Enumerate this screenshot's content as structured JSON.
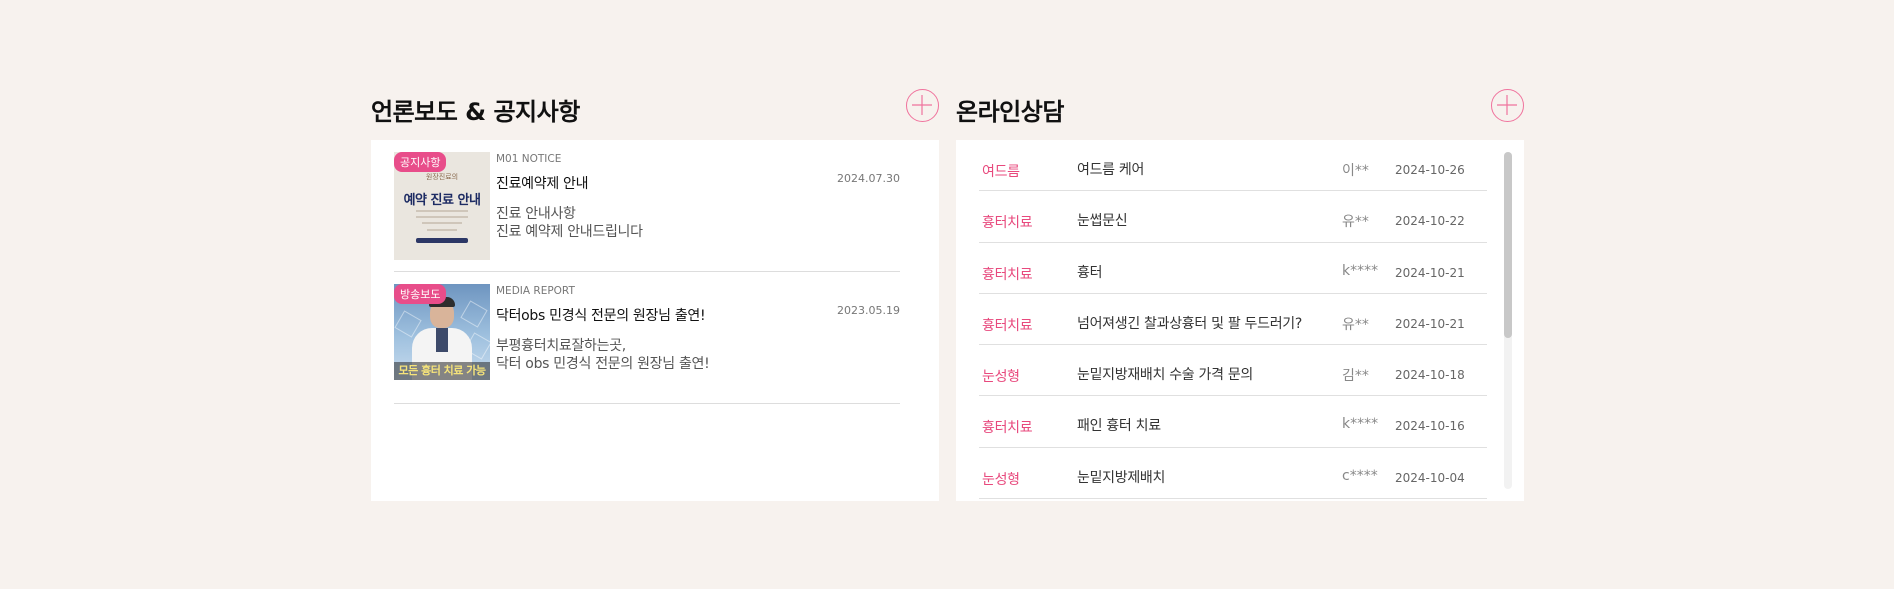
{
  "news": {
    "title": "언론보도 & 공지사항",
    "items": [
      {
        "badge": "공지사항",
        "category": "M01 NOTICE",
        "date": "2024.07.30",
        "title": "진료예약제 안내",
        "desc_line1": "진료 안내사항",
        "desc_line2": "진료 예약제 안내드립니다",
        "thumb_small": "원장진료의",
        "thumb_big": "예약 진료 안내"
      },
      {
        "badge": "방송보도",
        "category": "MEDIA REPORT",
        "date": "2023.05.19",
        "title": "닥터obs 민경식 전문의 원장님 출연!",
        "desc_line1": "부평흉터치료잘하는곳,",
        "desc_line2": "닥터 obs 민경식 전문의 원장님 출연!",
        "thumb_caption": "모든 흉터 치료 가능"
      }
    ]
  },
  "consult": {
    "title": "온라인상담",
    "rows": [
      {
        "category": "여드름",
        "title": "여드름 케어",
        "user": "이**",
        "date": "2024-10-26"
      },
      {
        "category": "흉터치료",
        "title": "눈썹문신",
        "user": "유**",
        "date": "2024-10-22"
      },
      {
        "category": "흉터치료",
        "title": "흉터",
        "user": "k****",
        "date": "2024-10-21"
      },
      {
        "category": "흉터치료",
        "title": "넘어져생긴 찰과상흉터 및 팔 두드러기?",
        "user": "유**",
        "date": "2024-10-21"
      },
      {
        "category": "눈성형",
        "title": "눈밑지방재배치 수술 가격 문의",
        "user": "김**",
        "date": "2024-10-18"
      },
      {
        "category": "흉터치료",
        "title": "패인 흉터 치료",
        "user": "k****",
        "date": "2024-10-16"
      },
      {
        "category": "눈성형",
        "title": "눈밑지방제배치",
        "user": "c****",
        "date": "2024-10-04"
      }
    ]
  },
  "colors": {
    "background": "#f7f2ee",
    "accent_pink": "#e8497d",
    "badge_pink": "#e84d8a"
  }
}
